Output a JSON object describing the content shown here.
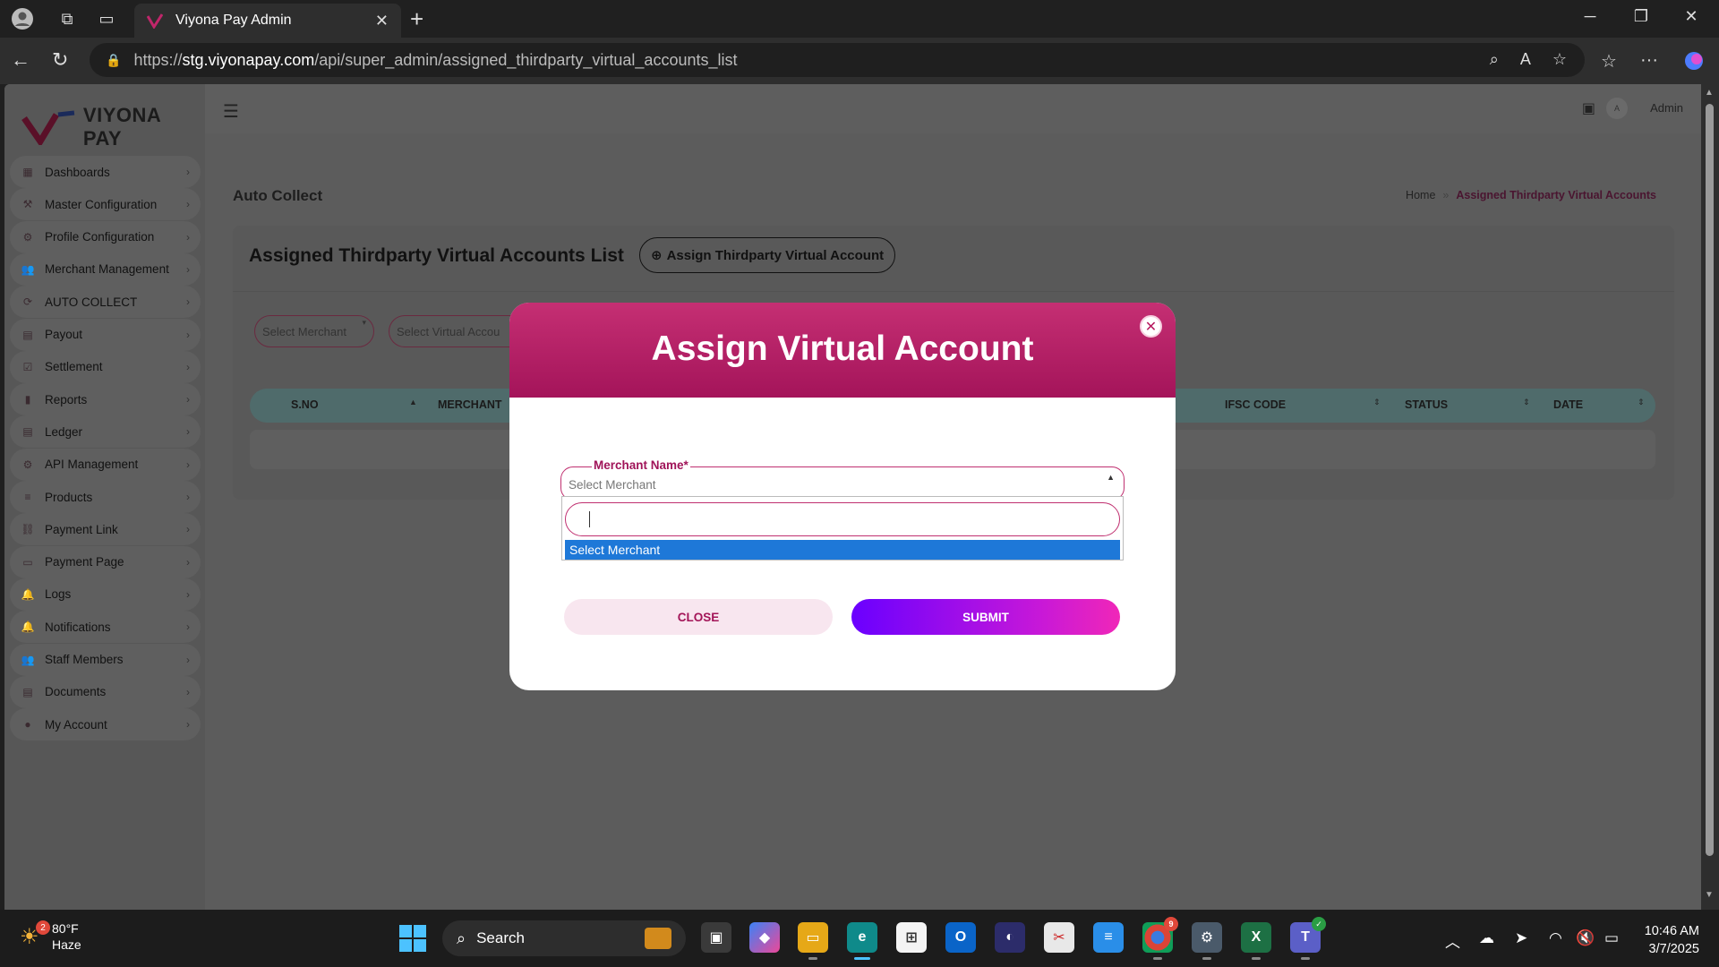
{
  "browser": {
    "tab_title": "Viyona Pay Admin",
    "url_prefix": "https://",
    "url_host": "stg.viyonapay.com",
    "url_path": "/api/super_admin/assigned_thirdparty_virtual_accounts_list"
  },
  "brand": {
    "name": "VIYONA PAY",
    "primary_color": "#a4145a",
    "accent_color": "#c52f73"
  },
  "sidebar": {
    "items": [
      {
        "label": "Dashboards",
        "icon": "grid-icon"
      },
      {
        "label": "Master Configuration",
        "icon": "wrench-icon"
      },
      {
        "label": "Profile Configuration",
        "icon": "gear-icon"
      },
      {
        "label": "Merchant Management",
        "icon": "users-icon"
      },
      {
        "label": "AUTO COLLECT",
        "icon": "refresh-icon"
      },
      {
        "label": "Payout",
        "icon": "payout-icon"
      },
      {
        "label": "Settlement",
        "icon": "checklist-icon"
      },
      {
        "label": "Reports",
        "icon": "chart-icon"
      },
      {
        "label": "Ledger",
        "icon": "ledger-icon"
      },
      {
        "label": "API Management",
        "icon": "cog-icon"
      },
      {
        "label": "Products",
        "icon": "list-icon"
      },
      {
        "label": "Payment Link",
        "icon": "link-icon"
      },
      {
        "label": "Payment Page",
        "icon": "page-icon"
      },
      {
        "label": "Logs",
        "icon": "bell-icon"
      },
      {
        "label": "Notifications",
        "icon": "bell-icon"
      },
      {
        "label": "Staff Members",
        "icon": "staff-icon"
      },
      {
        "label": "Documents",
        "icon": "document-icon"
      },
      {
        "label": "My Account",
        "icon": "account-icon"
      }
    ]
  },
  "topbar": {
    "avatar_letter": "A",
    "user": "Admin"
  },
  "page": {
    "section_title": "Auto Collect",
    "breadcrumb_home": "Home",
    "breadcrumb_current": "Assigned Thirdparty Virtual Accounts"
  },
  "card": {
    "title": "Assigned Thirdparty Virtual Accounts List",
    "assign_button": "Assign Thirdparty Virtual Account",
    "filter_merchant": "Select Merchant",
    "filter_virtual": "Select Virtual Accou",
    "columns": [
      "S.NO",
      "MERCHANT",
      "IFSC CODE",
      "STATUS",
      "DATE"
    ]
  },
  "modal": {
    "title": "Assign Virtual Account",
    "field_label": "Merchant Name*",
    "select_placeholder": "Select Merchant",
    "dropdown_option": "Select Merchant",
    "close_label": "CLOSE",
    "submit_label": "SUBMIT"
  },
  "taskbar": {
    "weather_badge": "2",
    "temperature": "80°F",
    "condition": "Haze",
    "search_label": "Search",
    "chrome_badge": "9",
    "time": "10:46 AM",
    "date": "3/7/2025"
  }
}
